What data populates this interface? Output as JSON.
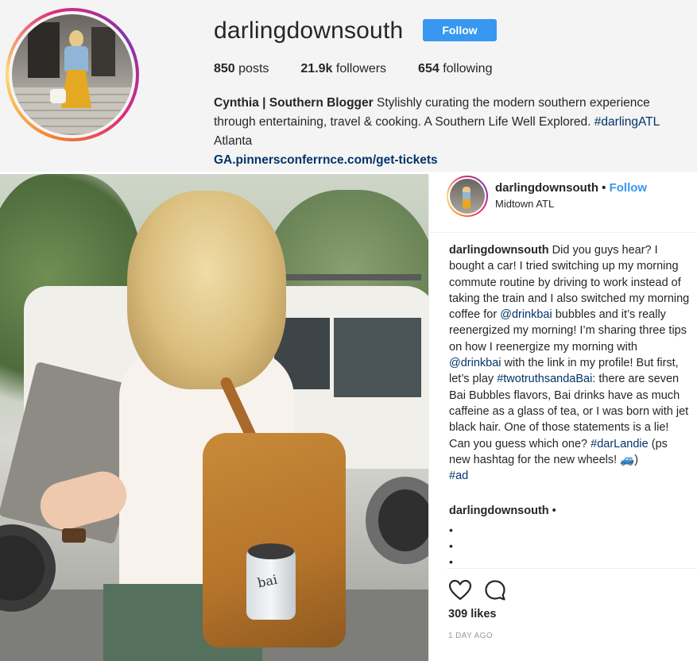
{
  "profile": {
    "username": "darlingdownsouth",
    "follow_label": "Follow",
    "stats": [
      {
        "value": "850",
        "label": "posts"
      },
      {
        "value": "21.9k",
        "label": "followers"
      },
      {
        "value": "654",
        "label": "following"
      }
    ],
    "bio": {
      "name": "Cynthia | Southern Blogger",
      "text": " Stylishly curating the modern southern experience through entertaining, travel & cooking. A Southern Life Well Explored. ",
      "hashtag": "#darlingATL",
      "location": "Atlanta",
      "link": "GA.pinnersconferrnce.com/get-tickets"
    }
  },
  "post": {
    "header": {
      "username": "darlingdownsouth",
      "dot": " • ",
      "follow_label": "Follow",
      "location": "Midtown ATL"
    },
    "caption": {
      "username": "darlingdownsouth",
      "part1": " Did you guys hear? I bought a car! I tried switching up my morning commute routine by driving to work instead of taking the train and I also switched my morning coffee for ",
      "mention1": "@drinkbai",
      "part2": " bubbles and it’s really reenergized my morning! I’m sharing three tips on how I reenergize my morning with ",
      "mention2": "@drinkbai",
      "part3": " with the link in my profile! But first, let’s play ",
      "hashtag1": "#twotruthsandaBai",
      "part4": ": there are seven Bai Bubbles flavors, Bai drinks have as much caffeine as a glass of tea, or I was born with jet black hair. One of those statements is a lie! Can you guess which one? ",
      "hashtag2": "#darLandie",
      "part5": " (ps new hashtag for the new wheels! 🚙)",
      "hashtag3": "#ad"
    },
    "comment": {
      "username": "darlingdownsouth",
      "suffix": " •",
      "bullets": [
        "•",
        "•",
        "•"
      ]
    },
    "likes": "309 likes",
    "time_ago": "1 DAY AGO",
    "image_label": "bai"
  },
  "colors": {
    "accent": "#3897f0",
    "link": "#003569",
    "header_bg": "#f4f4f4"
  },
  "icons": [
    "heart-icon",
    "comment-icon"
  ]
}
